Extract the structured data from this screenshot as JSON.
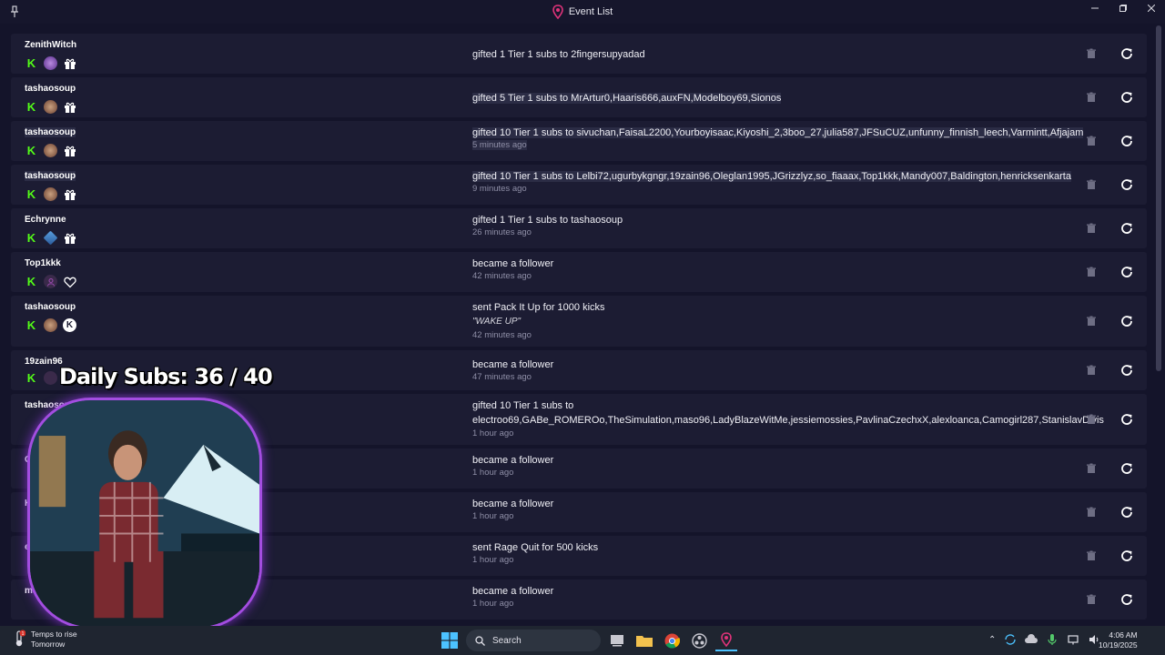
{
  "window": {
    "title": "Event List",
    "icons": [
      "pin-icon",
      "app-logo-icon",
      "minimize-icon",
      "maximize-icon",
      "close-icon"
    ]
  },
  "events": [
    {
      "user": "ZenithWitch",
      "message": "gifted 1 Tier 1 subs to 2fingersupyadad",
      "time": "",
      "badges": [
        "kick",
        "avatar-purple",
        "gift"
      ],
      "highlight": false
    },
    {
      "user": "tashaosoup",
      "message": "gifted 5 Tier 1 subs to MrArtur0,Haaris666,auxFN,Modelboy69,Sionos",
      "time": "",
      "badges": [
        "kick",
        "avatar-brown",
        "gift"
      ],
      "highlight": true
    },
    {
      "user": "tashaosoup",
      "message": "gifted 10 Tier 1 subs to sivuchan,FaisaL2200,Yourboyisaac,Kiyoshi_2,3boo_27,julia587,JFSuCUZ,unfunny_finnish_leech,Varmintt,Afjajam",
      "time": "5 minutes ago",
      "badges": [
        "kick",
        "avatar-brown",
        "gift"
      ],
      "highlight": true
    },
    {
      "user": "tashaosoup",
      "message": "gifted 10 Tier 1 subs to Lelbi72,ugurbykgngr,19zain96,Oleglan1995,JGrizzlyz,so_fiaaax,Top1kkk,Mandy007,Baldington,henricksenkarta",
      "time": "9 minutes ago",
      "badges": [
        "kick",
        "avatar-brown",
        "gift"
      ],
      "highlight": true
    },
    {
      "user": "Echrynne",
      "message": "gifted 1 Tier 1 subs to tashaosoup",
      "time": "26 minutes ago",
      "badges": [
        "kick",
        "avatar-diamond",
        "gift"
      ],
      "highlight": false
    },
    {
      "user": "Top1kkk",
      "message": "became a follower",
      "time": "42 minutes ago",
      "badges": [
        "kick",
        "avatar-default",
        "heart"
      ],
      "highlight": false
    },
    {
      "user": "tashaosoup",
      "message": "sent Pack It Up for 1000 kicks",
      "quote": "\"WAKE UP\"",
      "time": "42 minutes ago",
      "badges": [
        "kick",
        "avatar-brown",
        "coin"
      ],
      "highlight": false
    },
    {
      "user": "19zain96",
      "message": "became a follower",
      "time": "47 minutes ago",
      "badges": [
        "kick",
        "avatar-default",
        "heart"
      ],
      "highlight": false
    },
    {
      "user": "tashaosoup",
      "message": "gifted 10 Tier 1 subs to",
      "message2": "electroo69,GABe_ROMEROo,TheSimulation,maso96,LadyBlazeWitMe,jessiemossies,PavlinaCzechxX,alexloanca,Camogirl287,StanislavDivis",
      "time": "1 hour ago",
      "badges": [
        "kick",
        "avatar-brown",
        "gift"
      ],
      "highlight": false
    },
    {
      "user": "GA",
      "message": "became a follower",
      "time": "1 hour ago",
      "badges": [
        "kick",
        "avatar-default",
        "heart"
      ],
      "highlight": false
    },
    {
      "user": "K",
      "message": "became a follower",
      "time": "1 hour ago",
      "badges": [
        "kick",
        "avatar-default",
        "heart"
      ],
      "highlight": false
    },
    {
      "user": "e",
      "message": "sent Rage Quit for 500 kicks",
      "time": "1 hour ago",
      "badges": [
        "kick",
        "avatar-default",
        "coin"
      ],
      "highlight": false
    },
    {
      "user": "mas",
      "message": "became a follower",
      "time": "1 hour ago",
      "badges": [
        "kick",
        "avatar-default",
        "heart"
      ],
      "highlight": false
    }
  ],
  "overlay": {
    "label": "Daily Subs:",
    "count": "36 / 40"
  },
  "taskbar": {
    "weather_line1": "Temps to rise",
    "weather_line2": "Tomorrow",
    "weather_badge": "1",
    "search_placeholder": "Search",
    "time": "4:06 AM",
    "date": "10/19/2025"
  },
  "colors": {
    "background": "#14142a",
    "row": "#1c1c33",
    "kick_green": "#53fc18",
    "webcam_border": "#a34de0"
  }
}
